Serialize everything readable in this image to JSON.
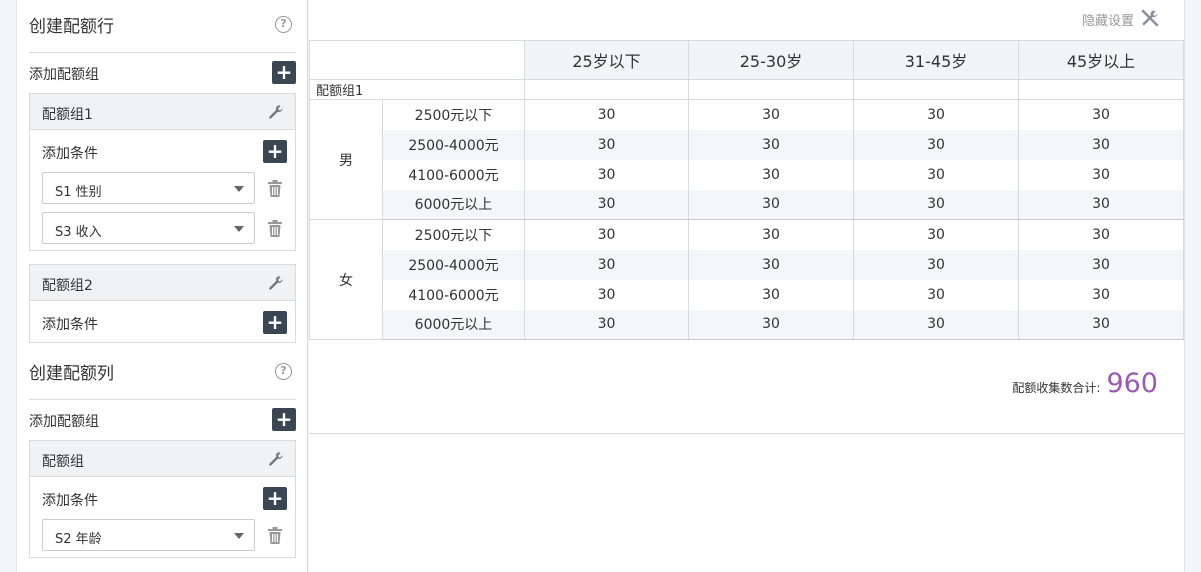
{
  "left": {
    "rows_section": {
      "title": "创建配额行",
      "add_group_label": "添加配额组",
      "groups": [
        {
          "name": "配额组1",
          "add_condition_label": "添加条件",
          "conditions": [
            "S1 性别",
            "S3 收入"
          ]
        },
        {
          "name": "配额组2",
          "add_condition_label": "添加条件",
          "conditions": []
        }
      ]
    },
    "cols_section": {
      "title": "创建配额列",
      "add_group_label": "添加配额组",
      "groups": [
        {
          "name": "配额组",
          "add_condition_label": "添加条件",
          "conditions": [
            "S2 年龄"
          ]
        }
      ]
    }
  },
  "right": {
    "hide_settings_label": "隐藏设置",
    "table": {
      "columns": [
        "25岁以下",
        "25-30岁",
        "31-45岁",
        "45岁以上"
      ],
      "group_label": "配额组1",
      "sections": [
        {
          "sex": "男",
          "rows": [
            {
              "income": "2500元以下",
              "values": [
                "30",
                "30",
                "30",
                "30"
              ]
            },
            {
              "income": "2500-4000元",
              "values": [
                "30",
                "30",
                "30",
                "30"
              ]
            },
            {
              "income": "4100-6000元",
              "values": [
                "30",
                "30",
                "30",
                "30"
              ]
            },
            {
              "income": "6000元以上",
              "values": [
                "30",
                "30",
                "30",
                "30"
              ]
            }
          ]
        },
        {
          "sex": "女",
          "rows": [
            {
              "income": "2500元以下",
              "values": [
                "30",
                "30",
                "30",
                "30"
              ]
            },
            {
              "income": "2500-4000元",
              "values": [
                "30",
                "30",
                "30",
                "30"
              ]
            },
            {
              "income": "4100-6000元",
              "values": [
                "30",
                "30",
                "30",
                "30"
              ]
            },
            {
              "income": "6000元以上",
              "values": [
                "30",
                "30",
                "30",
                "30"
              ]
            }
          ]
        }
      ]
    },
    "total_label": "配额收集数合计:",
    "total_value": "960",
    "total_color": "#9b59b6"
  }
}
